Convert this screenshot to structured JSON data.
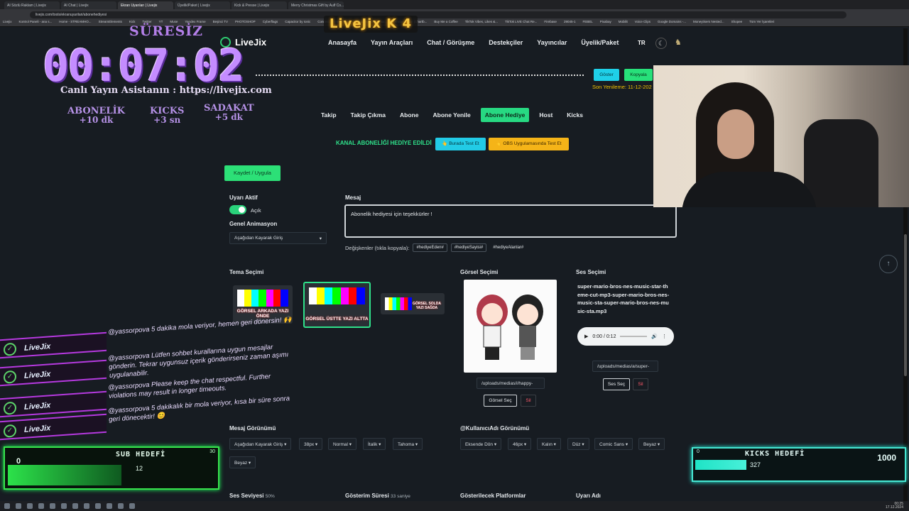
{
  "browser": {
    "tabs": [
      "AI Sözlü Raklam | Livejix",
      "AI Chat | Livejix",
      "Ekran Uyarıları | Livejix",
      "Üyelik/Paket | Livejix",
      "Kick & Presse | Livejix",
      "Merry Christmas Gift by Aulf Co...",
      "",
      ""
    ],
    "active_tab_index": 2,
    "url": "livejix.com/tools/ekranuyarilari/abonehediyesi",
    "bookmarks": [
      "Livejix",
      "Kontrol Paneli - ana s...",
      "Home - STREAMHO...",
      "StreamElements",
      "Kick",
      "Twitter",
      "YT",
      "Muse",
      "Yandex Frame",
      "Beşinci TV",
      "PHOTOSHOP",
      "Cyberflags",
      "Capacitor by Ionic",
      "Connect, Protect an...",
      "Squarespace Domai...",
      "Smilan Alkan (Chartb...",
      "Buy Me a Coffee",
      "TikTok Vibes, Likes &...",
      "TikTok LIVE Chat Re...",
      "Firebase",
      "29045-1",
      "FEBEL",
      "Pixabay",
      "Mobilit",
      "Voice Clips",
      "Google Domains -...",
      "Moneytisers Nested...",
      "Shopee",
      "Tüm Yer İşaretleri"
    ]
  },
  "site": {
    "brand": "LiveJix",
    "nav": [
      "Anasayfa",
      "Yayın Araçları",
      "Chat / Görüşme",
      "Destekçiler",
      "Yayıncılar",
      "Üyelik/Paket"
    ],
    "lang": "TR",
    "goster": "Göster",
    "kopyala": "Kopyala",
    "son_yenileme": "Son Yenileme: 11-12-202",
    "subtabs": [
      "Takip",
      "Takip Çıkma",
      "Abone",
      "Abone Yenile",
      "Abone Hediye",
      "Host",
      "Kicks"
    ],
    "active_subtab": 4,
    "banner": "KANAL ABONELİĞİ HEDİYE EDİLDİ",
    "test_here": "Burada Test Et",
    "test_obs": "OBS Uygulamasında Test Et",
    "save": "Kaydet / Uygula",
    "alert_active_label": "Uyarı Aktif",
    "toggle_state": "Açık",
    "general_anim_label": "Genel Animasyon",
    "general_anim_value": "Aşağıdan Kayarak Giriş",
    "message_label": "Mesaj",
    "message_value": "Abonelik hediyesi için teşekkürler !",
    "vars_label": "Değişkenler (tıkla kopyala):",
    "vars": [
      "#hediyeEden#",
      "#hediyeSayisi#",
      "#hediyeAlanlar#"
    ],
    "theme_label": "Tema Seçimi",
    "themes": [
      "GÖRSEL ARKADA YAZI ÖNDE",
      "GÖRSEL ÜSTTE YAZI ALTTA",
      "GÖRSEL SOLDA YAZI SAĞDA"
    ],
    "image_label": "Görsel Seçimi",
    "image_path": "/uploads/medias/i/happy-",
    "image_select": "Görsel Seç",
    "delete": "Sil",
    "sound_label": "Ses Seçimi",
    "sound_name": "super-mario-bros-nes-music-star-theme-cut-mp3-super-mario-bros-nes-music-sta-super-mario-bros-nes-music-sta.mp3",
    "audio_time": "0:00 / 0:12",
    "sound_path": "/uploads/medias/a/super-",
    "sound_select": "Ses Seç",
    "msg_view_label": "Mesaj Görünümü",
    "msg_view_opts": [
      "Aşağıdan Kayarak Giriş",
      "38px",
      "Normal",
      "İtalik",
      "Tahoma",
      "Beyaz"
    ],
    "user_view_label": "@KullanıcıAdı Görünümü",
    "user_view_opts": [
      "Eksende Dön",
      "46px",
      "Kalın",
      "Düz",
      "Comic Sans",
      "Beyaz"
    ],
    "volume_label": "Ses Seviyesi",
    "volume_value": "50%",
    "duration_label": "Gösterim Süresi",
    "duration_value": "33 saniye",
    "platforms_label": "Gösterilecek Platformlar",
    "alert_name_label": "Uyarı Adı"
  },
  "overlay": {
    "suresiz": "SÜRESİZ",
    "timer": "00:07:02",
    "assistant": "Canlı Yayın Asistanın : https://livejix.com",
    "stats": [
      {
        "title": "ABONELİK",
        "value": "+10 dk"
      },
      {
        "title": "KICKS",
        "value": "+3 sn"
      },
      {
        "title": "SADAKAT",
        "value": "+5 dk"
      }
    ],
    "stream_logo": "LiveJix K 4",
    "chat": [
      {
        "user": "LiveJix",
        "text": "@yassorpova 5 dakika mola veriyor, hemen geri dönersin! 🙌"
      },
      {
        "user": "LiveJix",
        "text": "@yassorpova Lütfen sohbet kurallarına uygun mesajlar gönderin. Tekrar uygunsuz içerik gönderirseniz zaman aşımı uygulanabilir."
      },
      {
        "user": "LiveJix",
        "text": "@yassorpova Please keep the chat respectful. Further violations may result in longer timeouts."
      },
      {
        "user": "LiveJix",
        "text": "@yassorpova 5 dakikalık bir mola veriyor, kısa bir süre sonra geri dönecektir! 😊"
      }
    ],
    "sub_goal": {
      "title": "SUB HEDEFİ",
      "min": "0",
      "max": "30",
      "current": "12"
    },
    "kicks_goal": {
      "title": "KICKS HEDEFİ",
      "min": "0",
      "max": "1000",
      "current": "327"
    }
  },
  "taskbar": {
    "time": "00:25",
    "date": "17.12.2024"
  }
}
